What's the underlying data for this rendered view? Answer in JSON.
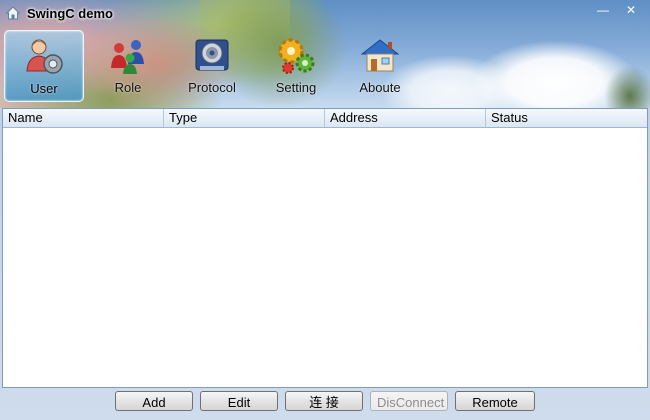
{
  "window": {
    "title": "SwingC demo",
    "minimize_glyph": "—",
    "close_glyph": "✕",
    "icon": "home-icon"
  },
  "toolbar": {
    "items": [
      {
        "label": "User",
        "icon": "user-icon",
        "active": true
      },
      {
        "label": "Role",
        "icon": "role-icon",
        "active": false
      },
      {
        "label": "Protocol",
        "icon": "protocol-icon",
        "active": false
      },
      {
        "label": "Setting",
        "icon": "gears-icon",
        "active": false
      },
      {
        "label": "Aboute",
        "icon": "house-icon",
        "active": false
      }
    ]
  },
  "table": {
    "columns": [
      "Name",
      "Type",
      "Address",
      "Status"
    ],
    "rows": []
  },
  "buttons": {
    "add": "Add",
    "edit": "Edit",
    "connect": "连 接",
    "disconnect": "DisConnect",
    "remote": "Remote"
  },
  "colors": {
    "active_tool": "#4a9ccb",
    "table_border": "#7f9db9",
    "header_sky": "#86acd8"
  }
}
